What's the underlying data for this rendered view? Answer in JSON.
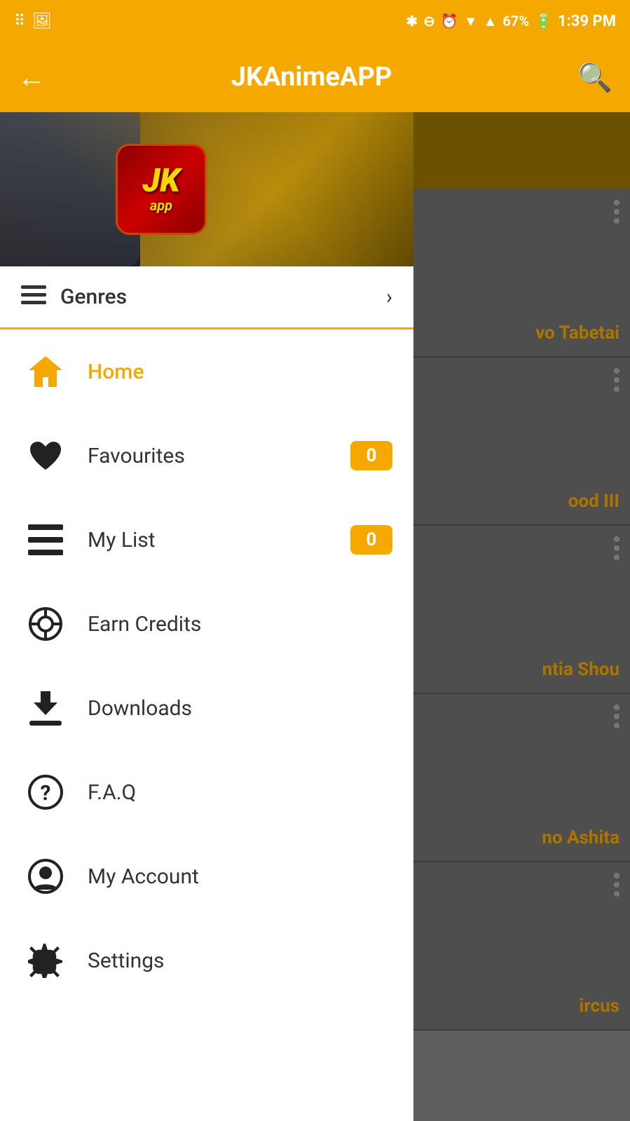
{
  "statusBar": {
    "battery": "67%",
    "time": "1:39 PM"
  },
  "topBar": {
    "title": "JKAnimeAPP",
    "backLabel": "←",
    "searchLabel": "🔍"
  },
  "banner": {
    "logoLine1": "JK",
    "logoLine2": "app"
  },
  "genres": {
    "label": "Genres",
    "arrow": "›"
  },
  "menuItems": [
    {
      "id": "home",
      "label": "Home",
      "icon": "home",
      "active": true,
      "badge": null
    },
    {
      "id": "favourites",
      "label": "Favourites",
      "icon": "heart",
      "active": false,
      "badge": "0"
    },
    {
      "id": "mylist",
      "label": "My List",
      "icon": "list",
      "active": false,
      "badge": "0"
    },
    {
      "id": "earncredits",
      "label": "Earn Credits",
      "icon": "search",
      "active": false,
      "badge": null
    },
    {
      "id": "downloads",
      "label": "Downloads",
      "icon": "download",
      "active": false,
      "badge": null
    },
    {
      "id": "faq",
      "label": "F.A.Q",
      "icon": "question",
      "active": false,
      "badge": null
    },
    {
      "id": "myaccount",
      "label": "My Account",
      "icon": "account",
      "active": false,
      "badge": null
    },
    {
      "id": "settings",
      "label": "Settings",
      "icon": "settings",
      "active": false,
      "badge": null
    }
  ],
  "rightPanel": {
    "items": [
      {
        "text": "vo Tabetai"
      },
      {
        "text": "ood III"
      },
      {
        "text": "ntia Shou"
      },
      {
        "text": "no Ashita"
      },
      {
        "text": "ircus"
      }
    ]
  }
}
